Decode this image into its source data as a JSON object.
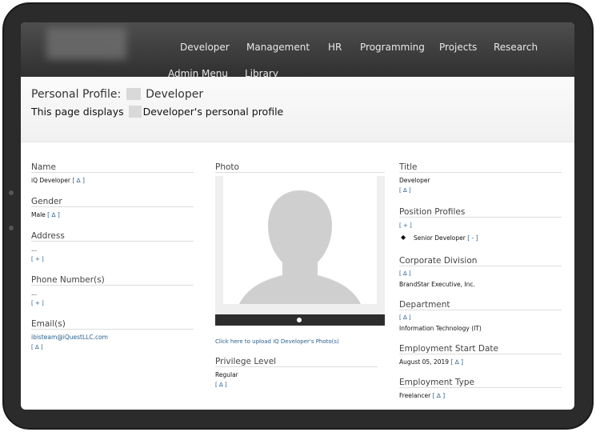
{
  "nav": {
    "items": [
      "Developer",
      "Management",
      "HR",
      "Programming",
      "Projects",
      "Research",
      "Admin Menu",
      "Library"
    ]
  },
  "header": {
    "title_prefix": "Personal Profile:",
    "title_suffix": "Developer",
    "subtitle_prefix": "This page displays",
    "subtitle_suffix": "Developer's personal profile"
  },
  "left": {
    "name_label": "Name",
    "name_value": "iQ Developer",
    "name_action": "[ ∆ ]",
    "gender_label": "Gender",
    "gender_value": "Male",
    "gender_action": "[ ∆ ]",
    "address_label": "Address",
    "address_value": "...",
    "address_action": "[ + ]",
    "phone_label": "Phone Number(s)",
    "phone_value": "...",
    "phone_action": "[ + ]",
    "email_label": "Email(s)",
    "email_value": "ibisteam@iQuestLLC.com",
    "email_action": "[ ∆ ]"
  },
  "middle": {
    "photo_label": "Photo",
    "upload_link": "Click here to upload iQ Developer's Photo(s)",
    "privilege_label": "Privilege Level",
    "privilege_value": "Regular",
    "privilege_action": "[ ∆ ]"
  },
  "right": {
    "title_label": "Title",
    "title_value": "Developer",
    "title_action": "[ ∆ ]",
    "position_label": "Position Profiles",
    "position_add": "[ + ]",
    "position_item": "Senior Developer",
    "position_remove": "[ - ]",
    "division_label": "Corporate Division",
    "division_action": "[ ∆ ]",
    "division_value": "BrandStar Executive, Inc.",
    "department_label": "Department",
    "department_action": "[ ∆ ]",
    "department_value": "Information Technology (IT)",
    "start_label": "Employment Start Date",
    "start_value": "August 05, 2019",
    "start_action": "[ ∆ ]",
    "type_label": "Employment Type",
    "type_value": "Freelancer",
    "type_action": "[ ∆ ]"
  },
  "colors": {
    "nav_bg": "#3c3c3c",
    "link": "#2a5f8c"
  }
}
